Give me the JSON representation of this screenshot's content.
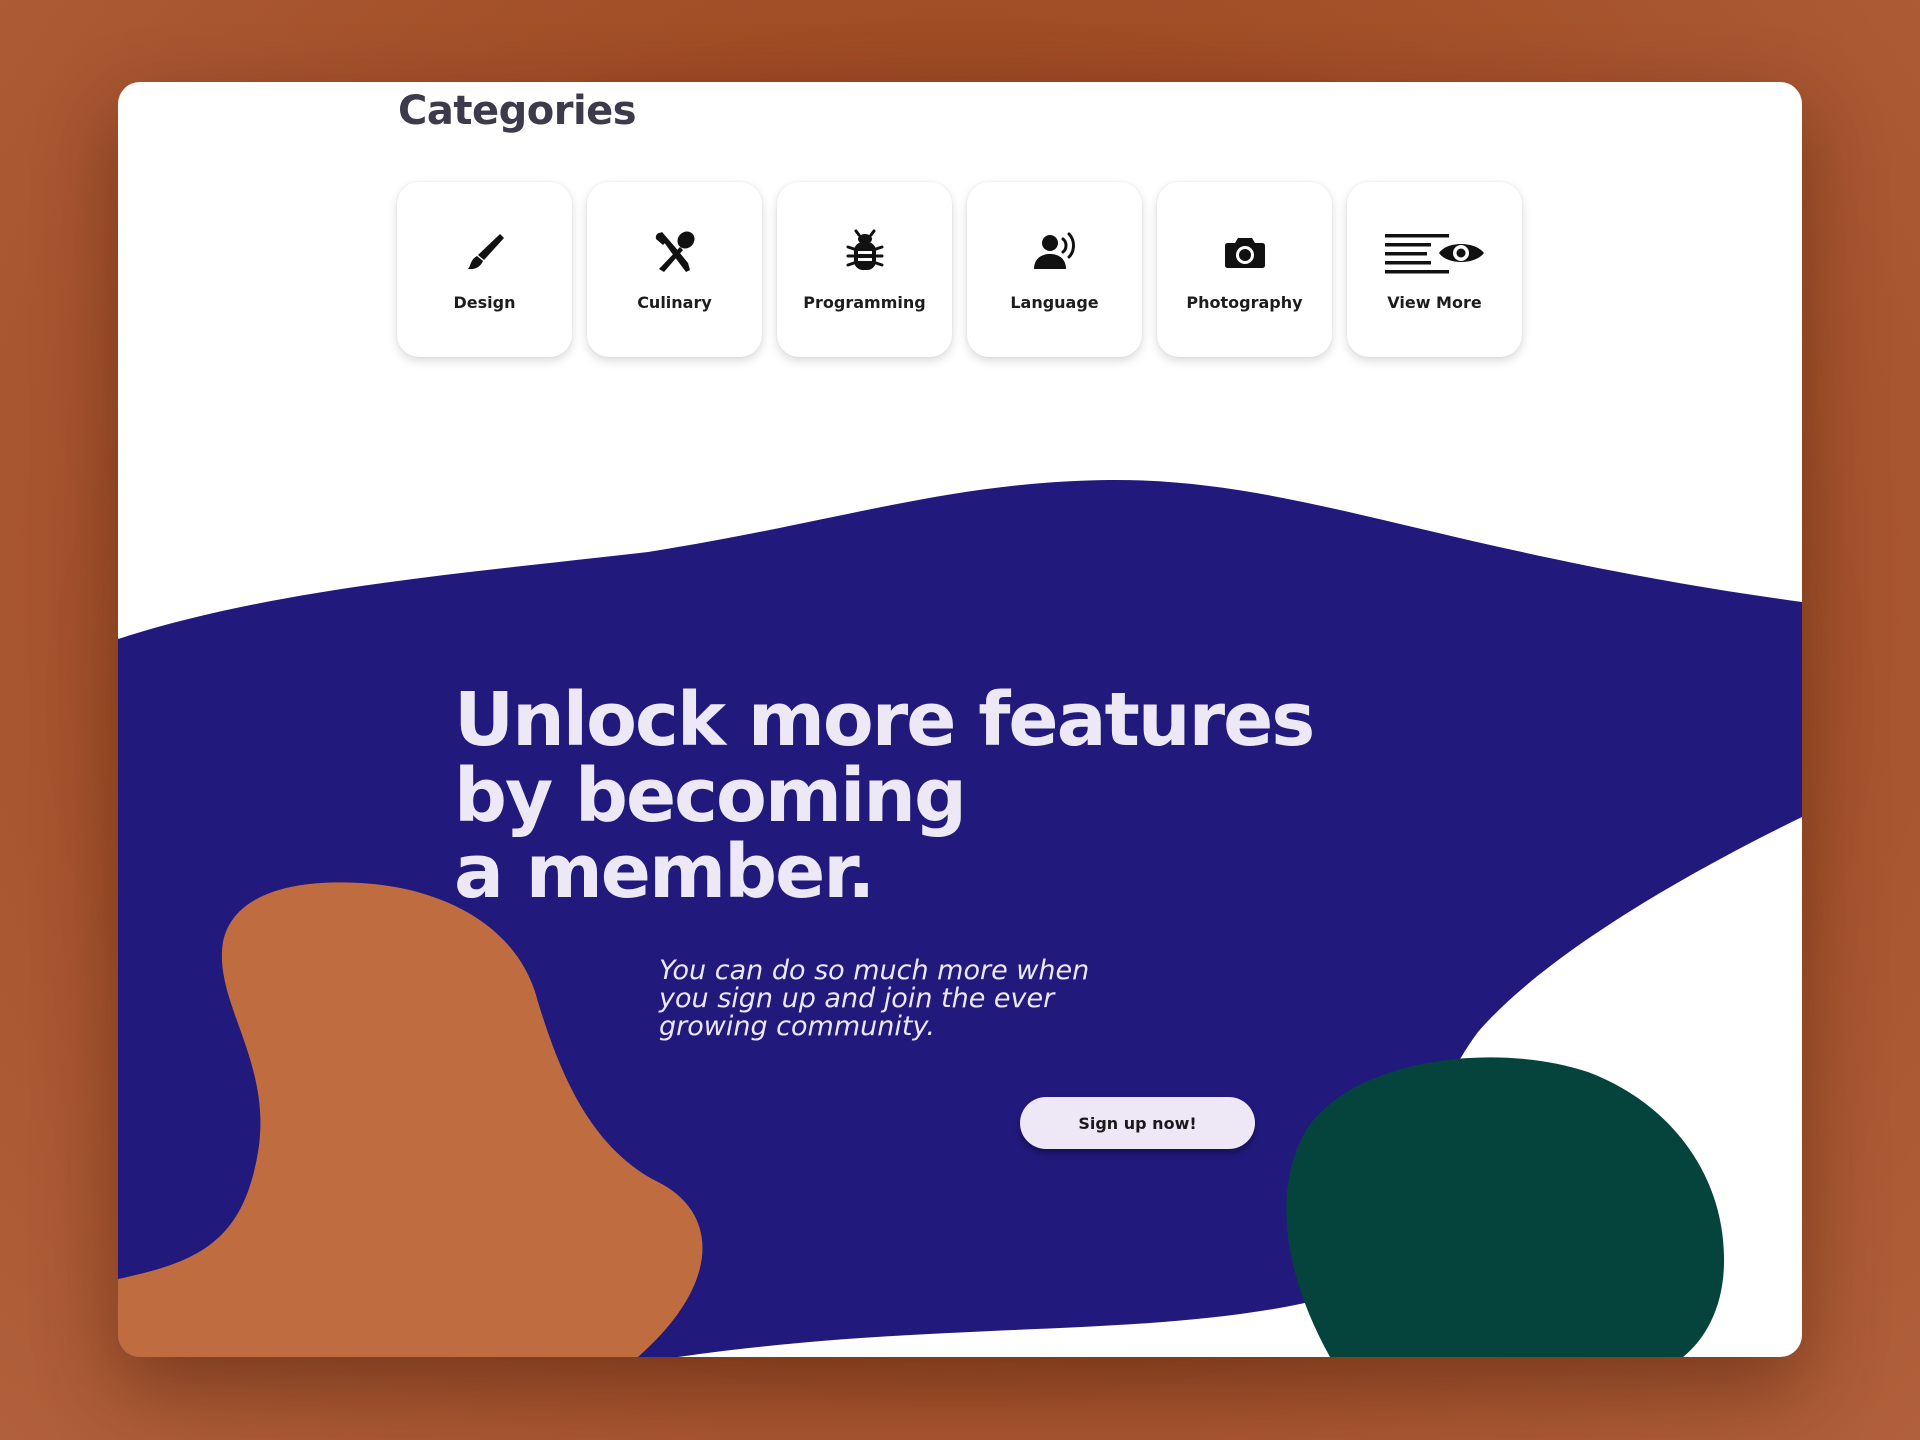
{
  "categories": {
    "title": "Categories",
    "items": [
      {
        "label": "Design",
        "icon": "paintbrush-icon"
      },
      {
        "label": "Culinary",
        "icon": "fork-spoon-icon"
      },
      {
        "label": "Programming",
        "icon": "bug-icon"
      },
      {
        "label": "Language",
        "icon": "speaking-person-icon"
      },
      {
        "label": "Photography",
        "icon": "camera-icon"
      },
      {
        "label": "View More",
        "icon": "eye-lines-icon"
      }
    ]
  },
  "hero": {
    "heading_lines": [
      "Unlock more features",
      "by becoming",
      "a member."
    ],
    "subtext_lines": [
      "You can do so much more when",
      "you sign up and join the ever",
      "growing community."
    ],
    "cta_label": "Sign up now!"
  },
  "colors": {
    "background": "#a14d26",
    "card": "#ffffff",
    "hero_blob": "#22197d",
    "orange_blob": "#bf6d40",
    "green_blob": "#05443c",
    "hero_text": "#ece8f6",
    "button": "#ede7f6"
  }
}
